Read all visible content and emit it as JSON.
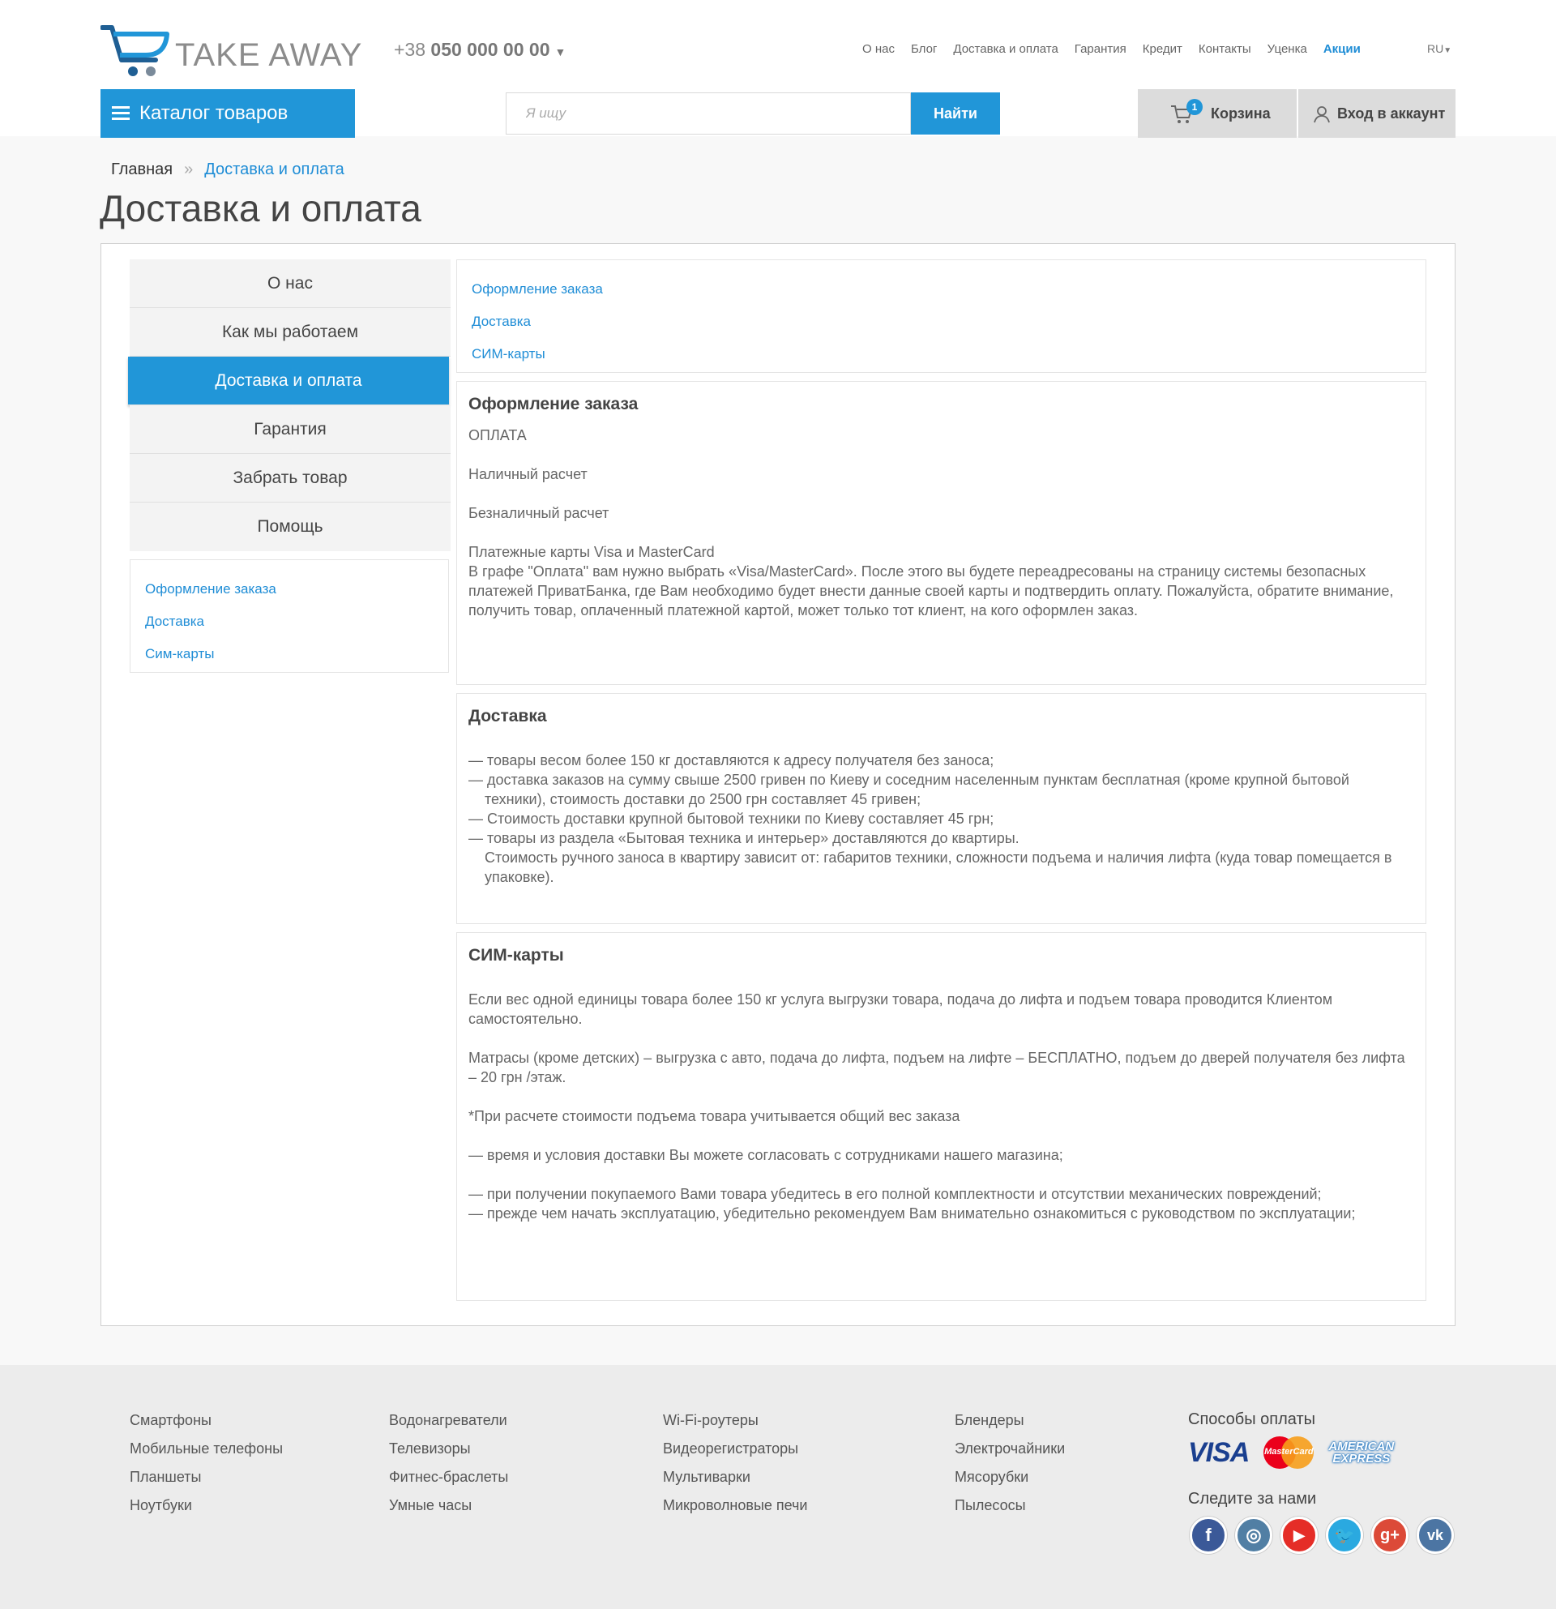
{
  "header": {
    "logo_text": "TAKE AWAY",
    "phone_prefix": "+38",
    "phone_number": "050 000 00 00",
    "nav": [
      "О нас",
      "Блог",
      "Доставка и оплата",
      "Гарантия",
      "Кредит",
      "Контакты",
      "Уценка",
      "Акции"
    ],
    "nav_active": "Акции",
    "lang": "RU",
    "catalog_label": "Каталог товаров",
    "search_placeholder": "Я ищу",
    "search_button": "Найти",
    "cart_label": "Корзина",
    "cart_count": "1",
    "login_label": "Вход в аккаунт"
  },
  "breadcrumb": {
    "home": "Главная",
    "separator": "»",
    "current": "Доставка и оплата"
  },
  "page_title": "Доставка и оплата",
  "sidebar": {
    "items": [
      {
        "label": "О нас"
      },
      {
        "label": "Как мы работаем"
      },
      {
        "label": "Доставка и оплата",
        "active": true
      },
      {
        "label": "Гарантия"
      },
      {
        "label": "Забрать товар"
      },
      {
        "label": "Помощь"
      }
    ],
    "links": [
      "Оформление заказа",
      "Доставка",
      "Сим-карты"
    ]
  },
  "toc": [
    "Оформление заказа",
    "Доставка",
    "СИМ-карты"
  ],
  "sections": {
    "order": {
      "title": "Оформление заказа",
      "payment_heading": "ОПЛАТА",
      "cash": "Наличный расчет",
      "cashless": "Безналичный расчет",
      "cards_title": "Платежные карты Visa и MasterCard",
      "cards_text": "В графе \"Оплата\" вам нужно выбрать «Visa/MasterCard». После этого вы будете переадресованы на страницу системы безопасных платежей ПриватБанка, где Вам необходимо будет внести данные своей карты и подтвердить оплату. Пожалуйста, обратите внимание, получить товар, оплаченный платежной картой, может только тот клиент, на кого оформлен заказ."
    },
    "delivery": {
      "title": "Доставка",
      "line1": "— товары весом более 150 кг доставляются к адресу получателя без заноса;",
      "line2": "— доставка заказов на сумму свыше 2500 гривен по Киеву и соседним населенным пунктам бесплатная (кроме крупной бытовой техники), стоимость доставки до 2500 грн составляет 45 гривен;",
      "line3": "— Стоимость доставки крупной бытовой техники по Киеву составляет 45 грн;",
      "line4": "— товары из раздела «Бытовая техника и интерьер» доставляются до квартиры.",
      "line5": "Стоимость ручного заноса в квартиру зависит от: габаритов техники,  сложности подъема и наличия лифта (куда товар помещается в упаковке)."
    },
    "sim": {
      "title": "СИМ-карты",
      "p1": "Если вес одной единицы товара более 150 кг услуга выгрузки товара, подача до лифта и подъем товара проводится Клиентом самостоятельно.",
      "p2": "Матрасы (кроме детских) – выгрузка с авто, подача до лифта, подъем на лифте – БЕСПЛАТНО, подъем до дверей получателя без лифта – 20 грн /этаж.",
      "p3": "*При расчете стоимости подъема товара учитывается общий вес заказа",
      "p4": "— время и условия доставки Вы можете согласовать с сотрудниками нашего магазина;",
      "p5": "— при получении покупаемого Вами товара убедитесь в его полной комплектности и отсутствии механических повреждений;",
      "p6": "— прежде чем начать эксплуатацию, убедительно рекомендуем Вам внимательно ознакомиться с руководством по эксплуатации;"
    }
  },
  "footer": {
    "col1": [
      "Смартфоны",
      "Мобильные телефоны",
      "Планшеты",
      "Ноутбуки"
    ],
    "col2": [
      "Водонагреватели",
      "Телевизоры",
      "Фитнес-браслеты",
      "Умные часы"
    ],
    "col3": [
      "Wi-Fi-роутеры",
      "Видеорегистраторы",
      "Мультиварки",
      "Микроволновые печи"
    ],
    "col4": [
      "Блендеры",
      "Электрочайники",
      "Мясорубки",
      "Пылесосы"
    ],
    "payment_title": "Способы оплаты",
    "payment_logos": {
      "visa": "VISA",
      "mastercard": "MasterCard",
      "amex_line1": "AMERICAN",
      "amex_line2": "EXPRESS"
    },
    "follow_title": "Следите за нами",
    "social": [
      {
        "name": "facebook-icon",
        "glyph": "f",
        "color": "#3b5998"
      },
      {
        "name": "instagram-icon",
        "glyph": "◎",
        "color": "#517fa4"
      },
      {
        "name": "youtube-icon",
        "glyph": "▶",
        "color": "#e52d27"
      },
      {
        "name": "twitter-icon",
        "glyph": "🐦",
        "color": "#2aa9e0"
      },
      {
        "name": "google-plus-icon",
        "glyph": "g+",
        "color": "#dc4a38"
      },
      {
        "name": "vk-icon",
        "glyph": "vk",
        "color": "#4c75a3"
      }
    ]
  },
  "colors": {
    "accent": "#2196d8",
    "link": "#1f8dd6",
    "footer_bg": "#ececec"
  }
}
